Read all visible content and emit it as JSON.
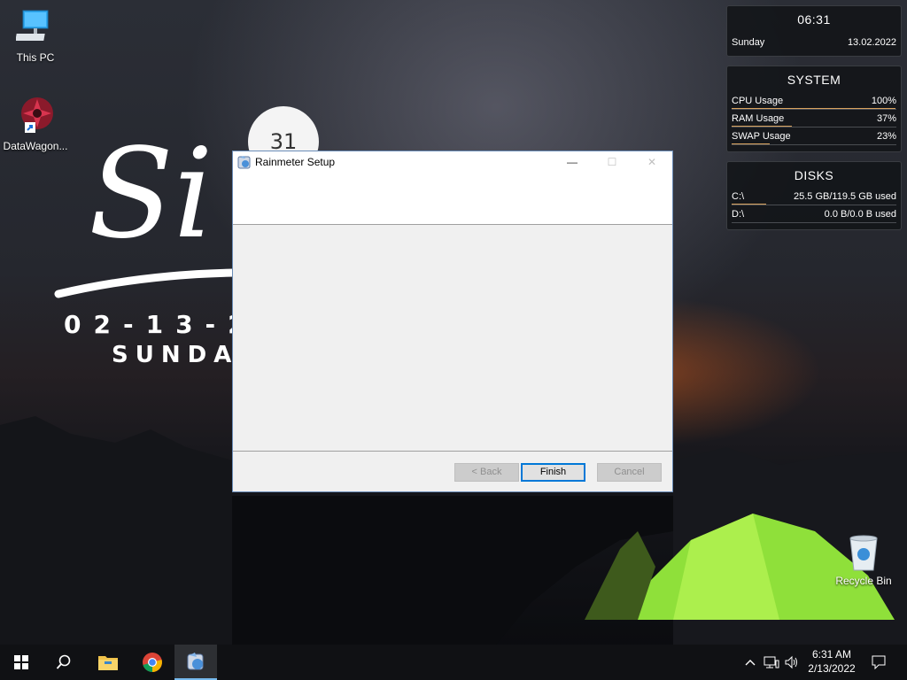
{
  "desktop": {
    "icons": [
      {
        "label": "This PC"
      },
      {
        "label": "DataWagon..."
      }
    ],
    "recycle_bin": {
      "label": "Recycle Bin"
    },
    "clock_skin": {
      "circle_number": "31",
      "script_text": "Si",
      "date": "02-13-20",
      "day": "SUNDAY"
    }
  },
  "widgets": {
    "time": {
      "time": "06:31",
      "day": "Sunday",
      "date": "13.02.2022"
    },
    "system": {
      "title": "SYSTEM",
      "rows": [
        {
          "label": "CPU Usage",
          "value": "100%",
          "level": 1.0
        },
        {
          "label": "RAM Usage",
          "value": "37%",
          "level": 0.37
        },
        {
          "label": "SWAP Usage",
          "value": "23%",
          "level": 0.23
        }
      ]
    },
    "disks": {
      "title": "DISKS",
      "rows": [
        {
          "label": "C:\\",
          "value": "25.5 GB/119.5 GB used",
          "level": 0.21
        },
        {
          "label": "D:\\",
          "value": "0.0 B/0.0 B used",
          "level": 0.0
        }
      ]
    }
  },
  "dialog": {
    "title": "Rainmeter Setup",
    "buttons": {
      "back": "< Back",
      "finish": "Finish",
      "cancel": "Cancel"
    },
    "title_controls": {
      "minimize": "—",
      "maximize": "☐",
      "close": "✕"
    }
  },
  "taskbar": {
    "clock_time": "6:31 AM",
    "clock_date": "2/13/2022",
    "accent": "#76b9ed"
  }
}
